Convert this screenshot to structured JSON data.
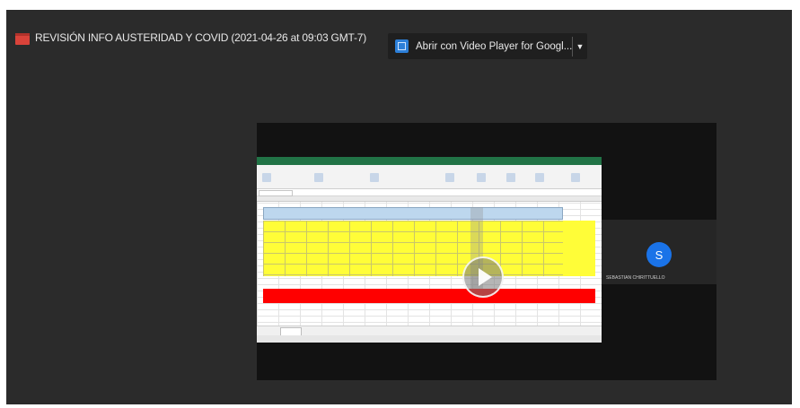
{
  "header": {
    "title": "REVISIÓN INFO AUSTERIDAD Y COVID (2021-04-26 at 09:03 GMT-7)",
    "doc_icon": "video-file-icon",
    "open_with": {
      "label": "Abrir con Video Player for Googl...",
      "app_icon": "video-player-app-icon",
      "dropdown_icon": "caret-down-icon"
    }
  },
  "video": {
    "play_icon": "play-icon",
    "participant": {
      "initial": "S",
      "name": "SEBASTIAN CHIRITTUELLO",
      "avatar_color": "#1a73e8"
    }
  },
  "colors": {
    "background": "#2b2b2b",
    "excel_green": "#217346",
    "highlight_yellow": "#fffd38",
    "highlight_red": "#ff0000"
  }
}
